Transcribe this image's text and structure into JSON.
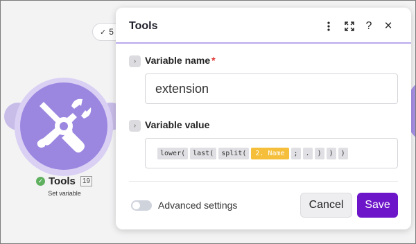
{
  "canvas": {
    "operations_badge": "5",
    "module": {
      "name": "Tools",
      "id": "19",
      "subtitle": "Set variable"
    }
  },
  "panel": {
    "title": "Tools",
    "header_icons": [
      "more-vertical-icon",
      "expand-icon",
      "help-icon",
      "close-icon"
    ],
    "fields": {
      "variable_name": {
        "label": "Variable name",
        "required_mark": "*",
        "value": "extension"
      },
      "variable_value": {
        "label": "Variable value",
        "tokens": [
          "lower(",
          "last(",
          "split(",
          "2. Name",
          ";",
          ".",
          ")",
          ")",
          ")"
        ]
      }
    },
    "advanced_settings": {
      "label": "Advanced settings",
      "enabled": false
    },
    "buttons": {
      "cancel": "Cancel",
      "save": "Save"
    }
  },
  "colors": {
    "accent": "#6d16c9",
    "module_purple": "#9b86e0",
    "variable_token": "#f5bf3b",
    "header_underline": "#b9a9ec"
  }
}
